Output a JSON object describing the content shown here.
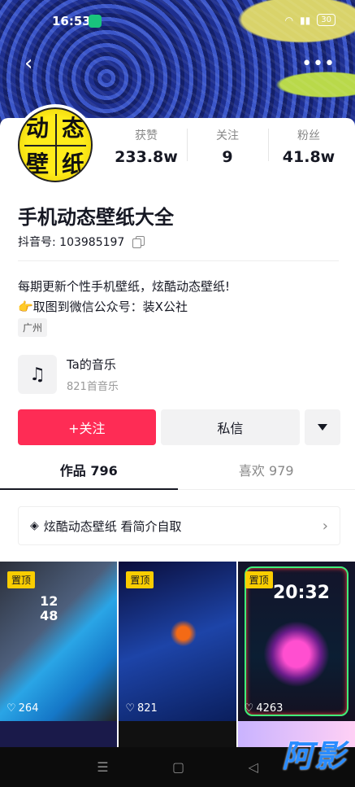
{
  "status_bar": {
    "time": "16:53",
    "battery": "30"
  },
  "profile": {
    "avatar_chars": [
      "动",
      "态",
      "壁",
      "纸"
    ],
    "name": "手机动态壁纸大全",
    "douyin_id_label": "抖音号: 103985197",
    "stats": [
      {
        "label": "获赞",
        "value": "233.8w"
      },
      {
        "label": "关注",
        "value": "9"
      },
      {
        "label": "粉丝",
        "value": "41.8w"
      }
    ],
    "bio_line1": "每期更新个性手机壁纸，炫酷动态壁纸!",
    "bio_line2": "👉取图到微信公众号：装X公社",
    "location": "广州"
  },
  "music": {
    "icon": "music-note-icon",
    "title": "Ta的音乐",
    "subtitle": "821首音乐"
  },
  "actions": {
    "follow": "+关注",
    "message": "私信"
  },
  "tabs": [
    {
      "label": "作品 796",
      "active": true
    },
    {
      "label": "喜欢 979",
      "active": false
    }
  ],
  "promo": {
    "text": "炫酷动态壁纸 看简介自取",
    "chevron": "›"
  },
  "videos": [
    {
      "pin": "置顶",
      "likes": "264"
    },
    {
      "pin": "置顶",
      "likes": "821"
    },
    {
      "pin": "置顶",
      "likes": "4263"
    }
  ],
  "video_overlays": {
    "v1_time": "12\n48",
    "v3_time": "20:32"
  },
  "watermark": "阿影"
}
